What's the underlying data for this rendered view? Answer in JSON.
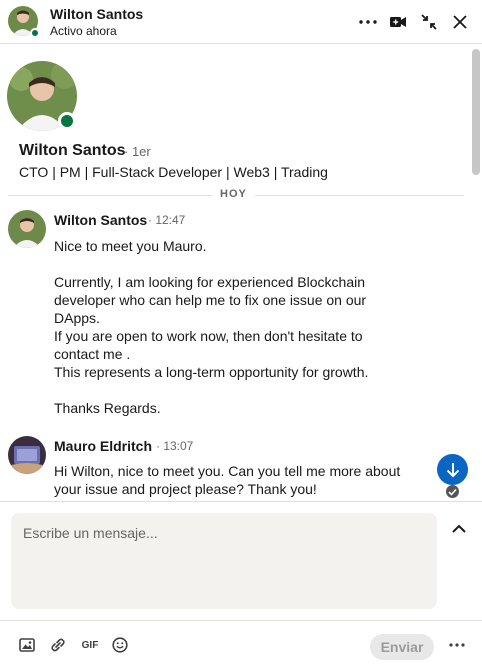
{
  "header": {
    "name": "Wilton Santos",
    "status": "Activo ahora"
  },
  "profile": {
    "name": "Wilton Santos",
    "degree": "· 1er",
    "headline": "CTO | PM | Full-Stack Developer | Web3 | Trading"
  },
  "divider": {
    "label": "HOY"
  },
  "messages": [
    {
      "sender": "Wilton Santos",
      "time": "· 12:47",
      "body": "Nice to meet you Mauro.\n\nCurrently, I am looking for experienced Blockchain developer who can help me to fix one issue on our DApps.\nIf you are open to work now, then don't hesitate to contact me .\nThis represents a long-term opportunity for growth.\n\nThanks Regards."
    },
    {
      "sender": "Mauro Eldritch",
      "time": "· 13:07",
      "body": "Hi Wilton, nice to meet you. Can you tell me more about your issue and project please? Thank you!"
    }
  ],
  "composer": {
    "placeholder": "Escribe un mensaje...",
    "value": ""
  },
  "footer": {
    "gif_label": "GIF",
    "send_label": "Enviar"
  },
  "colors": {
    "presence": "#057642",
    "accent": "#0a66c2",
    "composer_bg": "#f4f2ee"
  },
  "icons": [
    "more-icon",
    "video-call-icon",
    "minimize-icon",
    "close-icon",
    "arrow-down-icon",
    "check-icon",
    "chevron-up-icon",
    "image-icon",
    "attachment-icon",
    "emoji-icon"
  ]
}
